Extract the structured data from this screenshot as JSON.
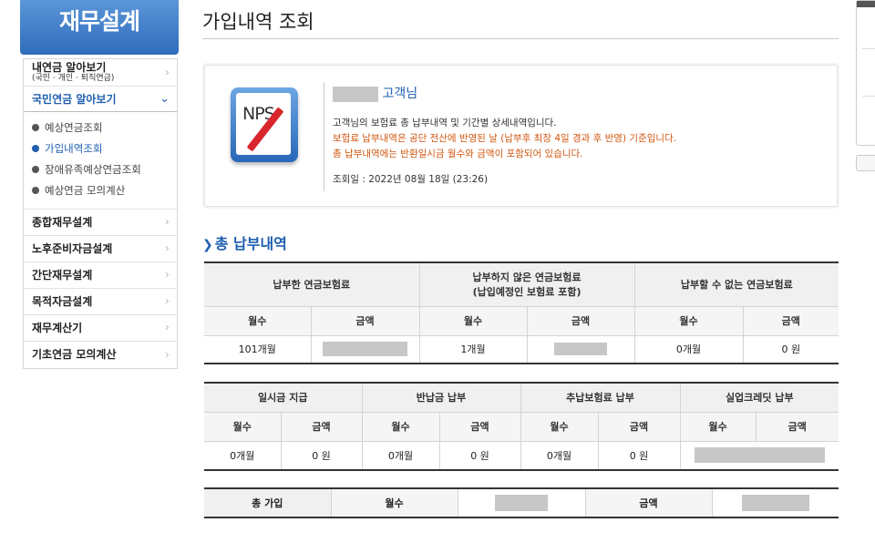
{
  "brand": "재무설계",
  "sidebar": {
    "first": {
      "label": "내연금 알아보기",
      "sub": "(국민 · 개인 · 퇴직연금)"
    },
    "active": "국민연금 알아보기",
    "subs": [
      "예상연금조회",
      "가입내역조회",
      "장애유족예상연금조회",
      "예상연금 모의계산"
    ],
    "items": [
      "종합재무설계",
      "노후준비자금설계",
      "간단재무설계",
      "목적자금설계",
      "재무계산기",
      "기초연금 모의계산"
    ]
  },
  "page_title": "가입내역 조회",
  "info": {
    "logo_text": "NPS",
    "customer_suffix": "고객님",
    "line1": "고객님의 보험료 총 납부내역 및 기간별 상세내역입니다.",
    "line2": "보험료 납부내역은 공단 전산에 반영된 날 (납부후 최장 4일 경과 후 반영) 기준입니다.",
    "line3": "총 납부내역에는 반환일시금 월수와 금액이 포함되어 있습니다.",
    "query_date": "조회일 : 2022년 08월 18일 (23:26)"
  },
  "section_title": "총 납부내역",
  "table1": {
    "groups": [
      "납부한 연금보험료",
      "납부하지 않은 연금보험료",
      "(납입예정인 보험료 포함)",
      "납부할 수 없는 연금보험료"
    ],
    "months_label": "월수",
    "amount_label": "금액",
    "values": [
      "101개월",
      "1개월",
      "0개월",
      "0 원"
    ]
  },
  "table2": {
    "groups": [
      "일시금 지급",
      "반납금 납부",
      "추납보험료 납부",
      "실업크레딧 납부"
    ],
    "months_label": "월수",
    "amount_label": "금액",
    "values": [
      "0개월",
      "0 원",
      "0개월",
      "0 원",
      "0개월",
      "0 원"
    ]
  },
  "table3": {
    "total_label": "총 가입",
    "months_label": "월수",
    "amount_label": "금액"
  }
}
